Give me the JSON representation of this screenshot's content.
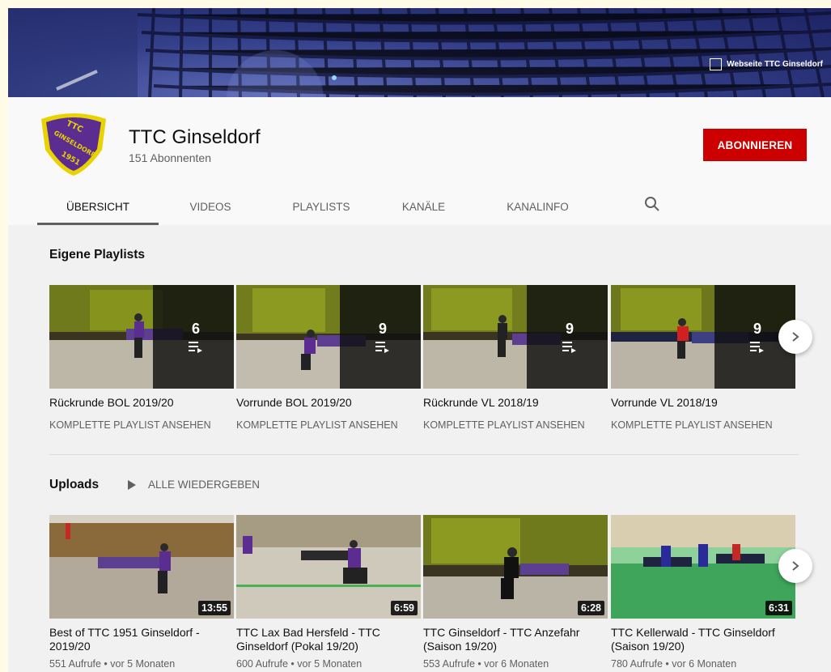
{
  "banner": {
    "link_label": "Webseite TTC Ginseldorf"
  },
  "channel": {
    "name": "TTC Ginseldorf",
    "subscribers": "151 Abonnenten",
    "subscribe_label": "ABONNIEREN",
    "logo": {
      "top_text": "TTC",
      "arc_text": "GINSELDORF",
      "year": "1951",
      "colors": {
        "shield": "#5b2d91",
        "ring": "#e8d200"
      }
    }
  },
  "tabs": [
    {
      "label": "Übersicht"
    },
    {
      "label": "Videos"
    },
    {
      "label": "Playlists"
    },
    {
      "label": "Kanäle"
    },
    {
      "label": "Kanalinfo"
    }
  ],
  "search_icon": "search-icon",
  "playlists_section": {
    "title": "Eigene Playlists",
    "items": [
      {
        "title": "Rückrunde BOL 2019/20",
        "count": "6",
        "link": "KOMPLETTE PLAYLIST ANSEHEN"
      },
      {
        "title": "Vorrunde BOL 2019/20",
        "count": "9",
        "link": "KOMPLETTE PLAYLIST ANSEHEN"
      },
      {
        "title": "Rückrunde VL 2018/19",
        "count": "9",
        "link": "KOMPLETTE PLAYLIST ANSEHEN"
      },
      {
        "title": "Vorrunde VL 2018/19",
        "count": "9",
        "link": "KOMPLETTE PLAYLIST ANSEHEN"
      }
    ]
  },
  "uploads_section": {
    "title": "Uploads",
    "play_all": "ALLE WIEDERGEBEN",
    "items": [
      {
        "title": "Best of TTC 1951 Ginseldorf - 2019/20",
        "duration": "13:55",
        "meta": "551 Aufrufe • vor 5 Monaten"
      },
      {
        "title": "TTC Lax Bad Hersfeld - TTC Ginseldorf (Pokal 19/20)",
        "duration": "6:59",
        "meta": "600 Aufrufe • vor 5 Monaten"
      },
      {
        "title": "TTC Ginseldorf - TTC Anzefahr (Saison 19/20)",
        "duration": "6:28",
        "meta": "553 Aufrufe • vor 6 Monaten"
      },
      {
        "title": "TTC Kellerwald - TTC Ginseldorf (Saison 19/20)",
        "duration": "6:31",
        "meta": "780 Aufrufe • vor 6 Monaten"
      }
    ]
  },
  "colors": {
    "accent": "#cc0000",
    "text": "#0f0f0f",
    "muted": "#606060",
    "page_bg": "#f1f1f1"
  }
}
